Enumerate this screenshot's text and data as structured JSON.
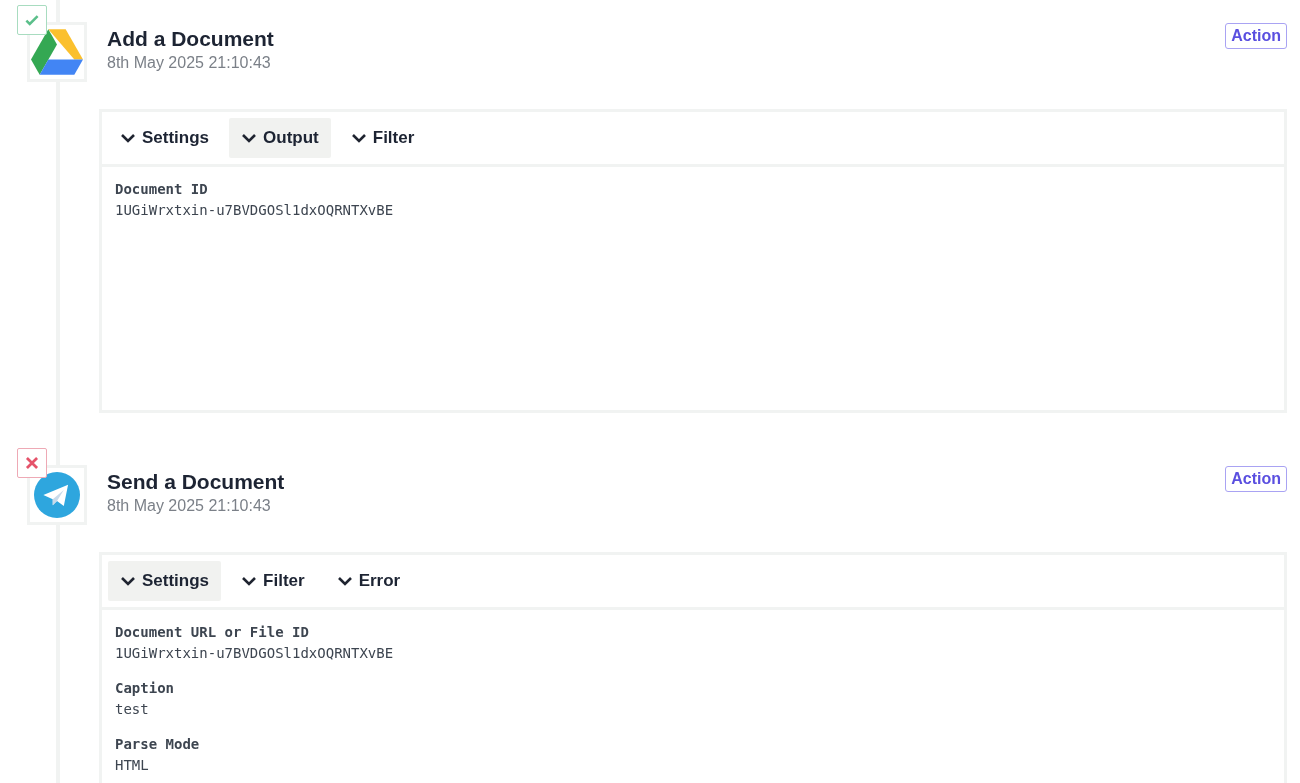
{
  "steps": [
    {
      "status": {
        "kind": "success"
      },
      "app": {
        "kind": "drive"
      },
      "title": "Add a Document",
      "time": "8th May 2025 21:10:43",
      "badge": "Action",
      "tabs": [
        {
          "label": "Settings",
          "selected": false
        },
        {
          "label": "Output",
          "selected": true
        },
        {
          "label": "Filter",
          "selected": false
        }
      ],
      "fields": [
        {
          "label": "Document ID",
          "value": "1UGiWrxtxin-u7BVDGOSl1dxOQRNTXvBE"
        }
      ]
    },
    {
      "status": {
        "kind": "error"
      },
      "app": {
        "kind": "telegram"
      },
      "title": "Send a Document",
      "time": "8th May 2025 21:10:43",
      "badge": "Action",
      "tabs": [
        {
          "label": "Settings",
          "selected": true
        },
        {
          "label": "Filter",
          "selected": false
        },
        {
          "label": "Error",
          "selected": false
        }
      ],
      "fields": [
        {
          "label": "Document URL or File ID",
          "value": "1UGiWrxtxin-u7BVDGOSl1dxOQRNTXvBE"
        },
        {
          "label": "Caption",
          "value": "test"
        },
        {
          "label": "Parse Mode",
          "value": "HTML"
        }
      ]
    }
  ]
}
